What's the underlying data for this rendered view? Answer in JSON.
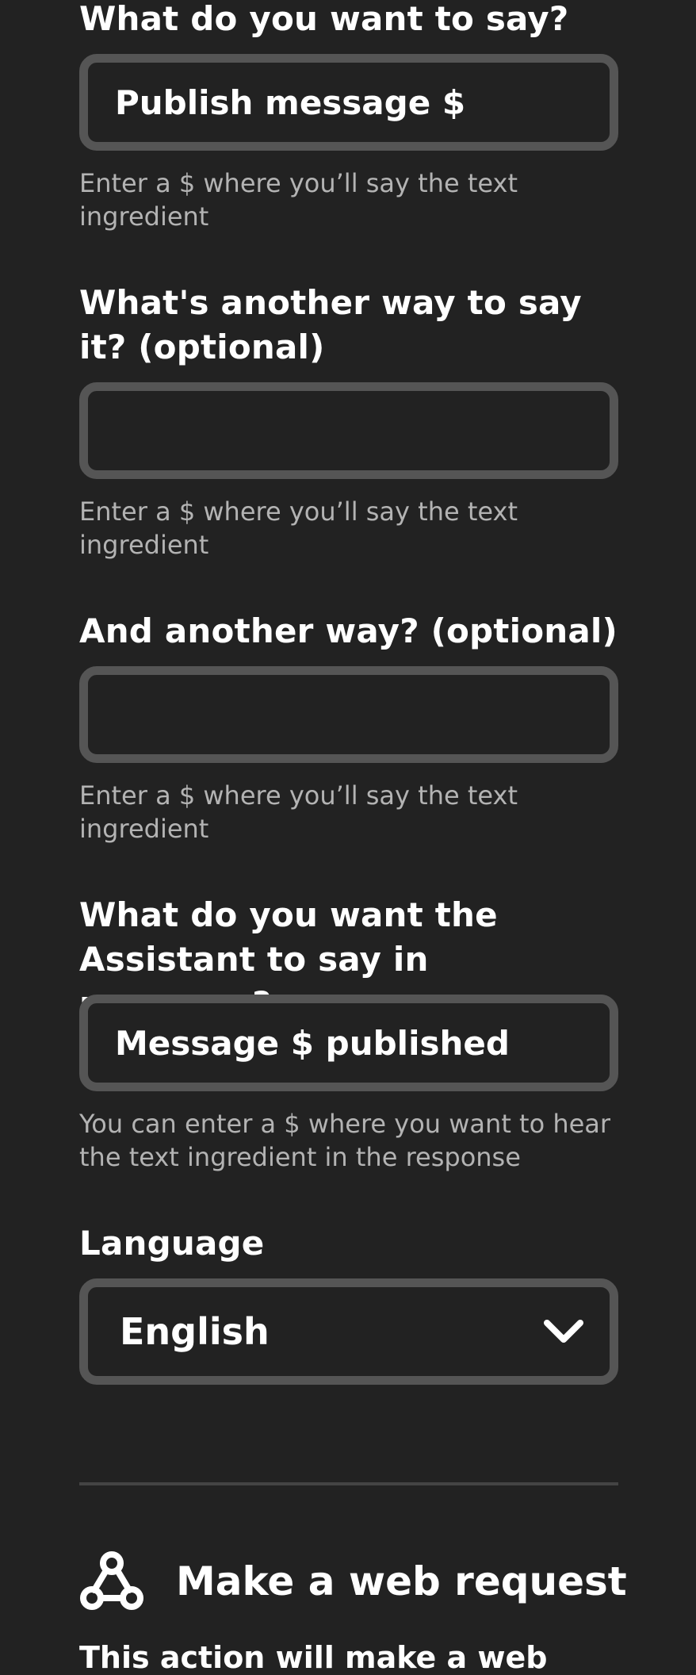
{
  "form": {
    "phrase1": {
      "label": "What do you want to say?",
      "value": "Publish message $",
      "hint": "Enter a $ where you’ll say the text ingredient"
    },
    "phrase2": {
      "label": "What's another way to say it? (optional)",
      "value": "",
      "hint": "Enter a $ where you’ll say the text ingredient"
    },
    "phrase3": {
      "label": "And another way? (optional)",
      "value": "",
      "hint": "Enter a $ where you’ll say the text ingredient"
    },
    "response": {
      "label": "What do you want the Assistant to say in response?",
      "value": "Message $ published",
      "hint": "You can enter a $ where you want to hear the text ingredient in the response"
    },
    "language": {
      "label": "Language",
      "selected": "English"
    }
  },
  "service": {
    "icon": "webhooks-icon",
    "title": "Make a web request",
    "description_partial": "This action will make a web"
  },
  "colors": {
    "background": "#222222",
    "field_border": "#555555",
    "hint_text": "#b3b3b3",
    "text": "#ffffff"
  }
}
